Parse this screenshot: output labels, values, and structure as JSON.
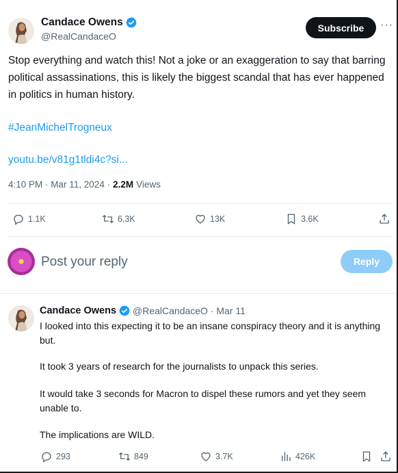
{
  "tweet": {
    "author_name": "Candace Owens",
    "handle": "@RealCandaceO",
    "subscribe_label": "Subscribe",
    "more_label": "···",
    "text": "Stop everything and watch this! Not a joke or an exaggeration to say that barring political assassinations, this is likely the biggest scandal that has ever happened in politics in human history.",
    "hashtag": "#JeanMichelTrogneux",
    "link": "youtu.be/v81g1tldi4c?si...",
    "time": "4:10 PM · Mar 11, 2024 ·",
    "views_count": "2.2M",
    "views_label": "Views",
    "actions": {
      "replies": "1.1K",
      "reposts": "6.3K",
      "likes": "13K",
      "bookmarks": "3.6K"
    }
  },
  "reply_bar": {
    "placeholder": "Post your reply",
    "button_label": "Reply"
  },
  "reply_tweet": {
    "author_name": "Candace Owens",
    "handle_date": "@RealCandaceO · Mar 11",
    "paragraphs": [
      "I looked into this expecting it to be an insane conspiracy theory and it is anything but.",
      "It took 3 years of research for the journalists to unpack this series.",
      "It would take 3 seconds for Macron to dispel these rumors and yet they seem unable to.",
      "The implications are WILD."
    ],
    "actions": {
      "replies": "293",
      "reposts": "849",
      "likes": "3.7K",
      "views": "426K"
    }
  },
  "colors": {
    "accent": "#1d9bf0",
    "text_primary": "#0f1419",
    "text_secondary": "#536471",
    "reply_button": "#8ecdf8"
  },
  "icons": [
    "verified-badge-icon",
    "more-icon",
    "reply-icon",
    "repost-icon",
    "like-icon",
    "bookmark-icon",
    "share-icon",
    "views-icon"
  ]
}
